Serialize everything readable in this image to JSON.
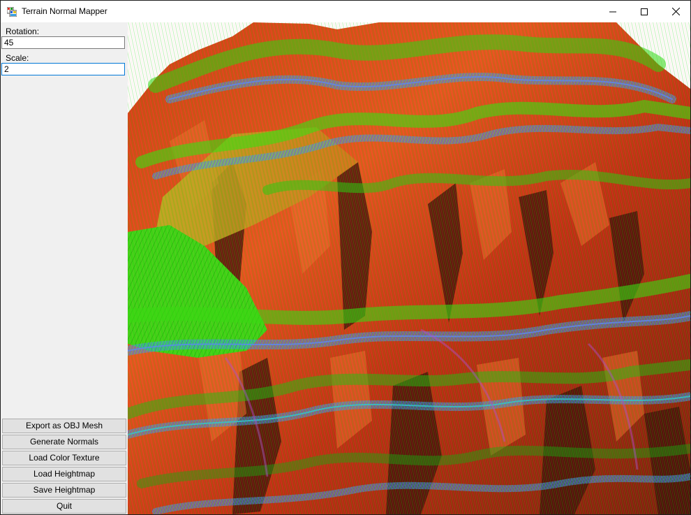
{
  "window": {
    "title": "Terrain Normal Mapper"
  },
  "sidebar": {
    "rotation": {
      "label": "Rotation:",
      "value": "45"
    },
    "scale": {
      "label": "Scale:",
      "value": "2"
    },
    "buttons": [
      {
        "label": "Export as OBJ Mesh"
      },
      {
        "label": "Generate Normals"
      },
      {
        "label": "Load Color Texture"
      },
      {
        "label": "Load Heightmap"
      },
      {
        "label": "Save Heightmap"
      },
      {
        "label": "Quit"
      }
    ]
  },
  "viewport": {
    "background": "#ffffff",
    "colors": {
      "terrain_red": "#e02010",
      "terrain_orange": "#e2631e",
      "normal_green": "#2ee010",
      "normal_blue": "#3a78e0",
      "normal_cyan": "#28c8c8",
      "shadow": "#2a0a05"
    }
  }
}
